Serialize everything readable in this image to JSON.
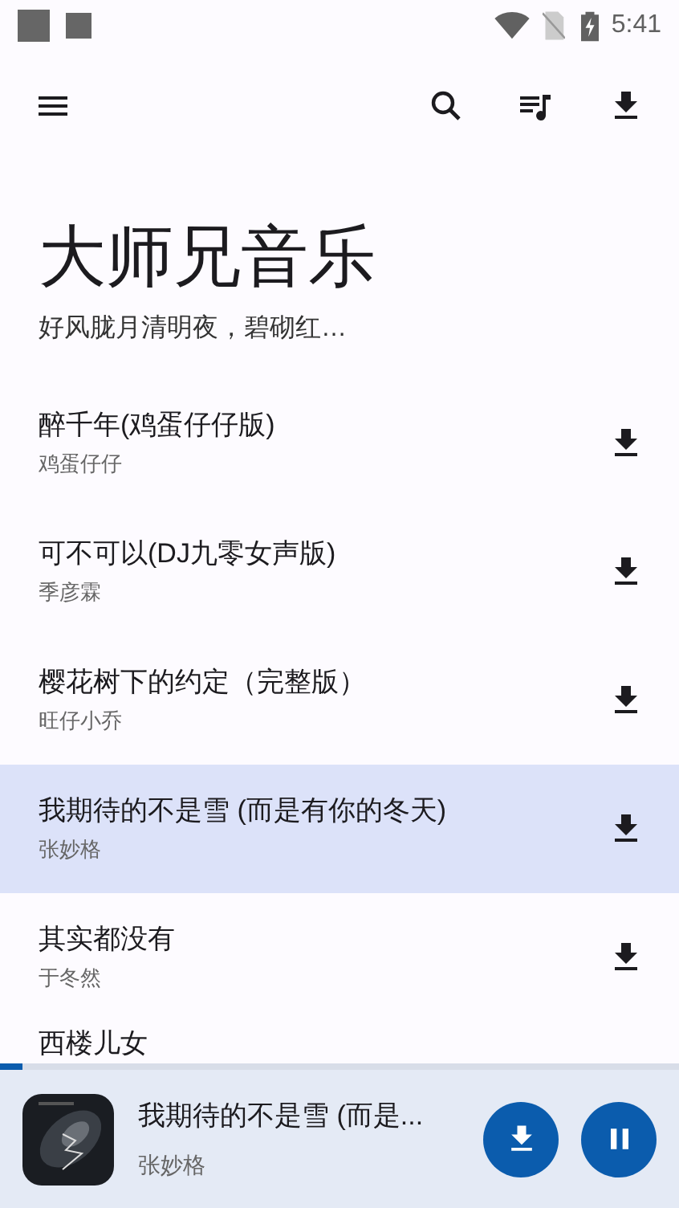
{
  "status_bar": {
    "time": "5:41"
  },
  "header": {
    "title": "大师兄音乐",
    "subtitle": "好风胧月清明夜，碧砌红…"
  },
  "songs": [
    {
      "title": "醉千年(鸡蛋仔仔版)",
      "artist": "鸡蛋仔仔",
      "selected": false
    },
    {
      "title": "可不可以(DJ九零女声版)",
      "artist": "季彦霖",
      "selected": false
    },
    {
      "title": "樱花树下的约定（完整版）",
      "artist": "旺仔小乔",
      "selected": false
    },
    {
      "title": "我期待的不是雪 (而是有你的冬天)",
      "artist": "张妙格",
      "selected": true
    },
    {
      "title": "其实都没有",
      "artist": "于冬然",
      "selected": false
    },
    {
      "kind": "cut_off",
      "title": "西楼儿女",
      "selected": false
    }
  ],
  "player": {
    "title": "我期待的不是雪 (而是...",
    "artist": "张妙格",
    "level": 0.033,
    "playing": true
  }
}
